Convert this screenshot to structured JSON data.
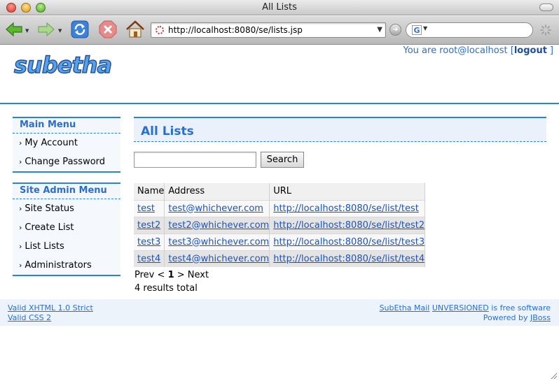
{
  "window": {
    "title": "All Lists"
  },
  "toolbar": {
    "url": "http://localhost:8080/se/lists.jsp",
    "search_engine_letter": "G"
  },
  "header": {
    "logo_text": "subetha",
    "user_prefix": "You are root@localhost [",
    "logout_label": "logout",
    "user_suffix": "]"
  },
  "sidebar": {
    "main_menu": {
      "title": "Main Menu",
      "items": [
        {
          "label": "My Account"
        },
        {
          "label": "Change Password"
        }
      ]
    },
    "admin_menu": {
      "title": "Site Admin Menu",
      "items": [
        {
          "label": "Site Status"
        },
        {
          "label": "Create List"
        },
        {
          "label": "List Lists"
        },
        {
          "label": "Administrators"
        }
      ]
    }
  },
  "main": {
    "title": "All Lists",
    "search": {
      "value": "",
      "button_label": "Search"
    },
    "table": {
      "headers": [
        "Name",
        "Address",
        "URL"
      ],
      "rows": [
        {
          "name": "test",
          "address": "test@whichever.com",
          "url": "http://localhost:8080/se/list/test"
        },
        {
          "name": "test2",
          "address": "test2@whichever.com",
          "url": "http://localhost:8080/se/list/test2"
        },
        {
          "name": "test3",
          "address": "test3@whichever.com",
          "url": "http://localhost:8080/se/list/test3"
        },
        {
          "name": "test4",
          "address": "test4@whichever.com",
          "url": "http://localhost:8080/se/list/test4"
        }
      ]
    },
    "pager": {
      "prev": "Prev",
      "lt": "<",
      "current": "1",
      "gt": ">",
      "next": "Next"
    },
    "total": "4 results total"
  },
  "footer": {
    "xhtml": "Valid XHTML 1.0 Strict",
    "css": "Valid CSS 2",
    "product": "SubEtha Mail",
    "version": "UNVERSIONED",
    "free_text": "is free software",
    "powered_prefix": "Powered by",
    "powered_link": "JBoss"
  },
  "colors": {
    "accent": "#2a84d4",
    "link": "#1b54b8",
    "panel": "#eaf1fa"
  }
}
